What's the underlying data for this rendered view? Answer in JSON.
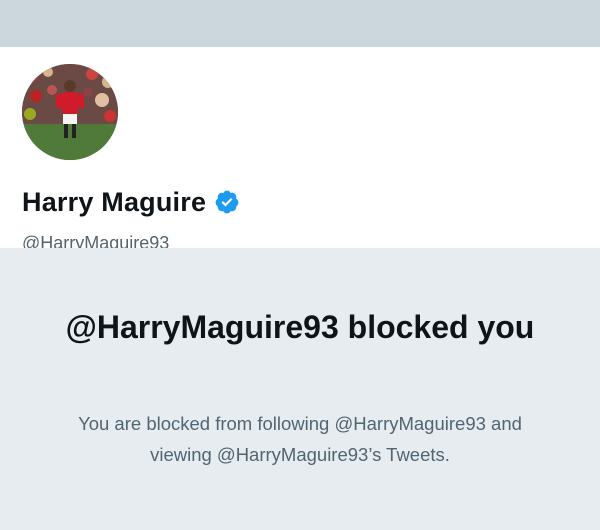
{
  "profile": {
    "display_name": "Harry Maguire",
    "handle": "@HarryMaguire93",
    "verified_icon": "verified-badge-icon",
    "avatar": "profile-photo"
  },
  "blocked": {
    "title": "@HarryMaguire93 blocked you",
    "message": "You are blocked from following @HarryMaguire93 and viewing @HarryMaguire93’s Tweets."
  },
  "colors": {
    "banner": "#ccd6dd",
    "background": "#e6ecf0",
    "verified_blue": "#1d9bf0",
    "primary_text": "#0f1419",
    "secondary_text": "#536471"
  }
}
